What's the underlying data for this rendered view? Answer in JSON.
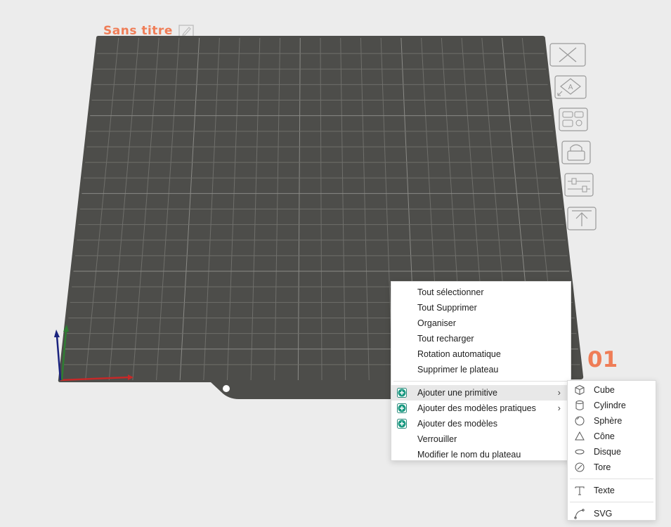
{
  "plate": {
    "title": "Sans titre",
    "number": "01",
    "accent_color": "#ef7d57",
    "bed_color": "#4d4d4a",
    "grid_color": "#6f6f6b"
  },
  "toolbar": {
    "buttons": [
      {
        "name": "remove-plate-icon",
        "icon": "close-x-icon"
      },
      {
        "name": "auto-orient-icon",
        "icon": "arrange-a-icon"
      },
      {
        "name": "arrange-icon",
        "icon": "grid-arrange-icon"
      },
      {
        "name": "lock-icon",
        "icon": "lock-icon"
      },
      {
        "name": "plate-settings-icon",
        "icon": "sliders-icon"
      },
      {
        "name": "move-to-top-icon",
        "icon": "arrow-up-bar-icon"
      }
    ]
  },
  "context_menu": {
    "items": [
      {
        "label": "Tout sélectionner"
      },
      {
        "label": "Tout Supprimer"
      },
      {
        "label": "Organiser"
      },
      {
        "label": "Tout recharger"
      },
      {
        "label": "Rotation automatique"
      },
      {
        "label": "Supprimer le plateau"
      }
    ],
    "items2": [
      {
        "label": "Ajouter une primitive",
        "icon": "add-icon",
        "submenu": true,
        "highlighted": true
      },
      {
        "label": "Ajouter des modèles pratiques",
        "icon": "add-icon",
        "submenu": true
      },
      {
        "label": "Ajouter des modèles",
        "icon": "add-icon"
      },
      {
        "label": "Verrouiller"
      },
      {
        "label": "Modifier le nom du plateau"
      }
    ]
  },
  "primitive_menu": {
    "items": [
      {
        "label": "Cube",
        "icon": "cube-icon"
      },
      {
        "label": "Cylindre",
        "icon": "cylinder-icon"
      },
      {
        "label": "Sphère",
        "icon": "sphere-icon"
      },
      {
        "label": "Cône",
        "icon": "cone-icon"
      },
      {
        "label": "Disque",
        "icon": "disc-icon"
      },
      {
        "label": "Tore",
        "icon": "torus-icon"
      }
    ],
    "text_item": {
      "label": "Texte",
      "icon": "text-icon"
    },
    "svg_item": {
      "label": "SVG",
      "icon": "svg-icon"
    }
  }
}
